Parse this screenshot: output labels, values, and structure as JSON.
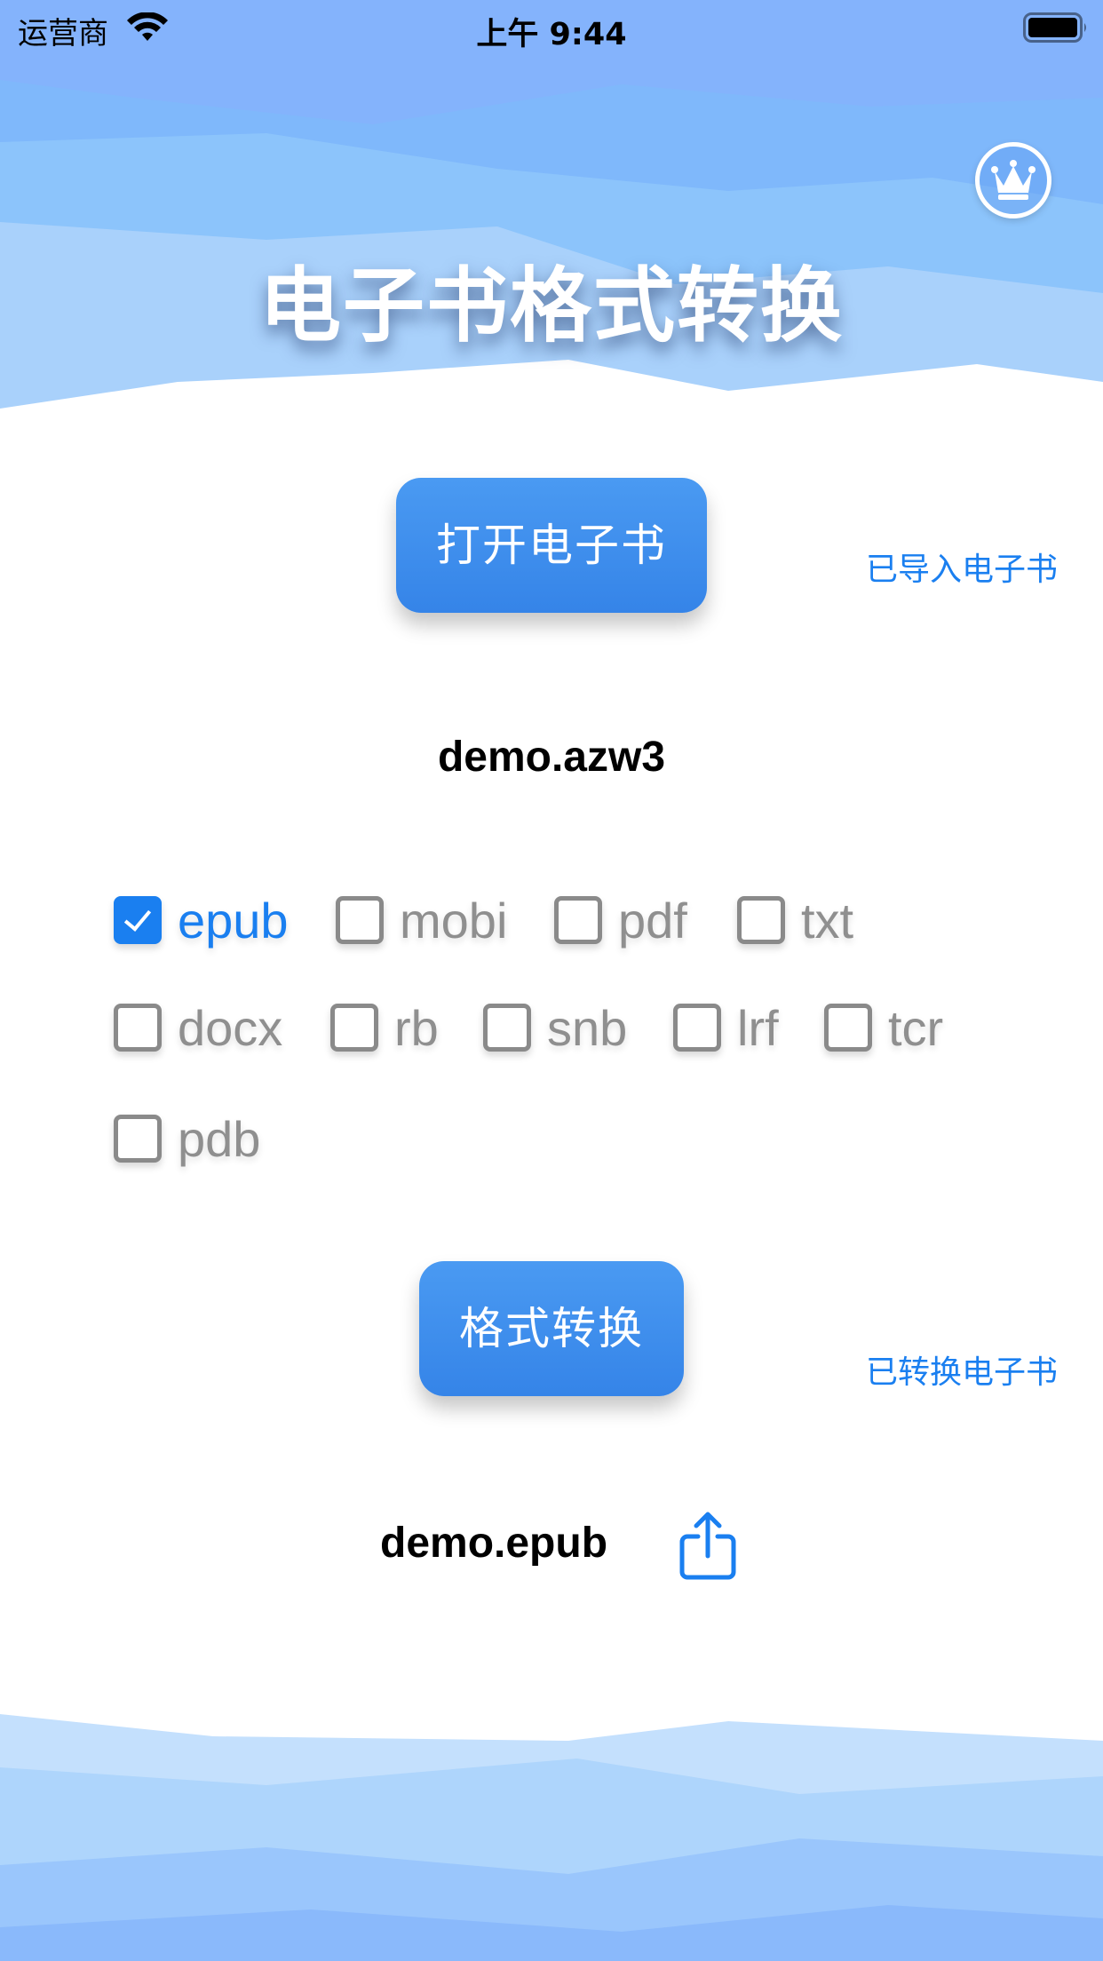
{
  "status_bar": {
    "carrier": "运营商",
    "time": "上午 9:44"
  },
  "header": {
    "title": "电子书格式转换"
  },
  "open_button": {
    "label": "打开电子书"
  },
  "imported_link": "已导入电子书",
  "source_file": "demo.azw3",
  "formats": [
    {
      "label": "epub",
      "checked": true
    },
    {
      "label": "mobi",
      "checked": false
    },
    {
      "label": "pdf",
      "checked": false
    },
    {
      "label": "txt",
      "checked": false
    },
    {
      "label": "docx",
      "checked": false
    },
    {
      "label": "rb",
      "checked": false
    },
    {
      "label": "snb",
      "checked": false
    },
    {
      "label": "lrf",
      "checked": false
    },
    {
      "label": "tcr",
      "checked": false
    },
    {
      "label": "pdb",
      "checked": false
    }
  ],
  "convert_button": {
    "label": "格式转换"
  },
  "converted_link": "已转换电子书",
  "output_file": "demo.epub",
  "colors": {
    "accent": "#1a7ff0",
    "button": "#3d8eee",
    "sky": "#84b8fb"
  },
  "icons": [
    "wifi-icon",
    "battery-icon",
    "crown-icon",
    "share-icon",
    "checkbox-icon"
  ]
}
